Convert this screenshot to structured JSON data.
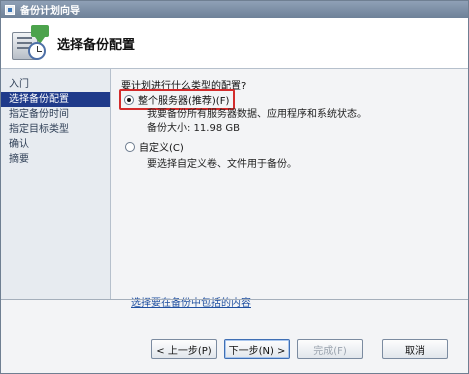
{
  "window": {
    "title": "备份计划向导"
  },
  "header": {
    "title": "选择备份配置"
  },
  "sidebar": {
    "items": [
      {
        "label": "入门",
        "active": false
      },
      {
        "label": "选择备份配置",
        "active": true
      },
      {
        "label": "指定备份时间",
        "active": false
      },
      {
        "label": "指定目标类型",
        "active": false
      },
      {
        "label": "确认",
        "active": false
      },
      {
        "label": "摘要",
        "active": false
      }
    ]
  },
  "main": {
    "question": "要计划进行什么类型的配置?",
    "option_full": {
      "label": "整个服务器(推荐)(F)",
      "selected": true,
      "description": "我要备份所有服务器数据、应用程序和系统状态。",
      "size_label": "备份大小: 11.98 GB"
    },
    "option_custom": {
      "label": "自定义(C)",
      "selected": false,
      "description": "要选择自定义卷、文件用于备份。"
    },
    "link": "选择要在备份中包括的内容"
  },
  "footer": {
    "back": "< 上一步(P)",
    "next": "下一步(N) >",
    "finish": "完成(F)",
    "cancel": "取消"
  },
  "colors": {
    "active_nav": "#1f3a8a",
    "highlight_border": "#d32c2c",
    "link": "#1f4fa0"
  }
}
